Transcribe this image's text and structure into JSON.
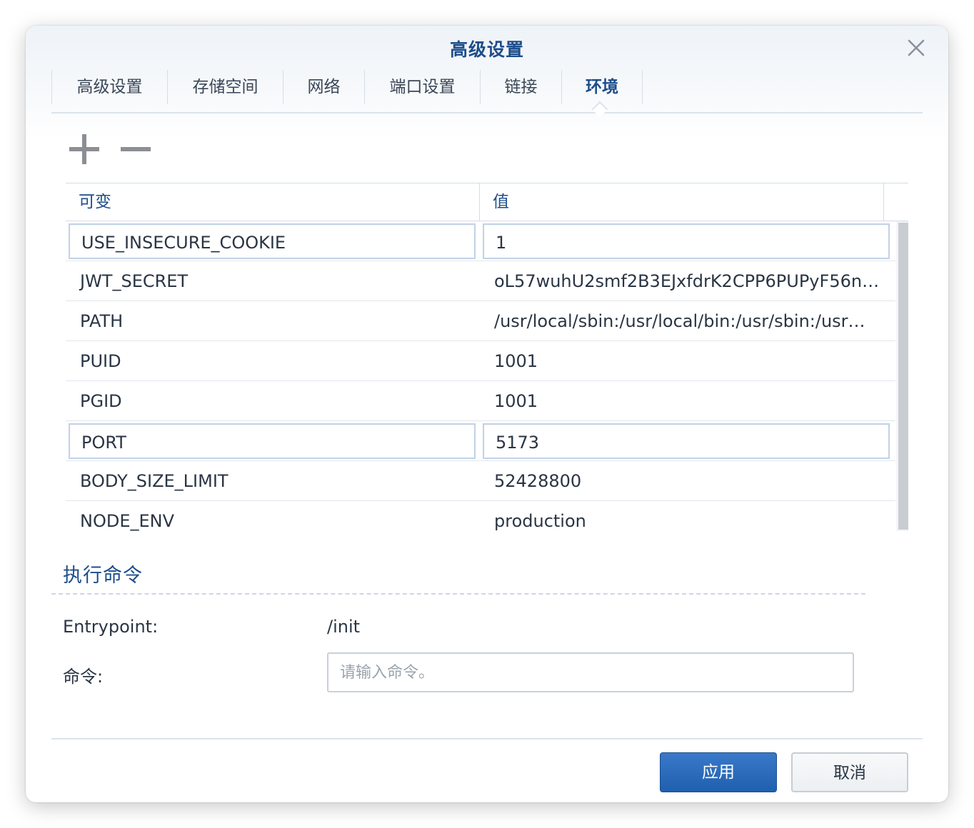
{
  "dialog": {
    "title": "高级设置"
  },
  "tabs": [
    {
      "label": "高级设置",
      "active": false
    },
    {
      "label": "存储空间",
      "active": false
    },
    {
      "label": "网络",
      "active": false
    },
    {
      "label": "端口设置",
      "active": false
    },
    {
      "label": "链接",
      "active": false
    },
    {
      "label": "环境",
      "active": true
    }
  ],
  "toolbar": {
    "add_icon": "plus-icon",
    "remove_icon": "minus-icon"
  },
  "env_table": {
    "columns": [
      "可变",
      "值"
    ],
    "rows": [
      {
        "name": "USE_INSECURE_COOKIE",
        "value": "1",
        "editing": true
      },
      {
        "name": "JWT_SECRET",
        "value": "oL57wuhU2smf2B3EJxfdrK2CPP6PUPyF56n…",
        "editing": false
      },
      {
        "name": "PATH",
        "value": "/usr/local/sbin:/usr/local/bin:/usr/sbin:/usr…",
        "editing": false
      },
      {
        "name": "PUID",
        "value": "1001",
        "editing": false
      },
      {
        "name": "PGID",
        "value": "1001",
        "editing": false
      },
      {
        "name": "PORT",
        "value": "5173",
        "editing": true
      },
      {
        "name": "BODY_SIZE_LIMIT",
        "value": "52428800",
        "editing": false
      },
      {
        "name": "NODE_ENV",
        "value": "production",
        "editing": false
      }
    ]
  },
  "exec": {
    "section_title": "执行命令",
    "entrypoint_label": "Entrypoint:",
    "entrypoint_value": "/init",
    "command_label": "命令:",
    "command_value": "",
    "command_placeholder": "请输入命令。"
  },
  "footer": {
    "apply_label": "应用",
    "cancel_label": "取消"
  },
  "colors": {
    "accent": "#1d4d8a",
    "primary_button": "#2866b8"
  }
}
